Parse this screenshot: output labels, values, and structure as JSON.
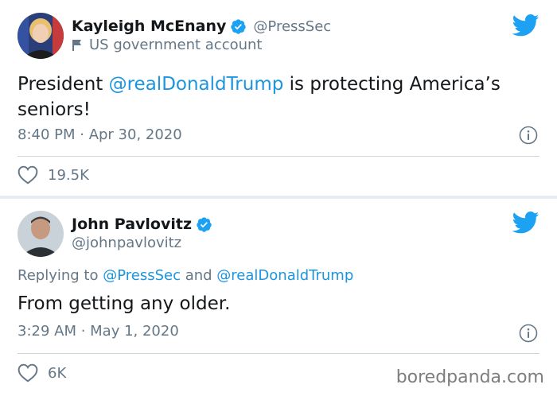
{
  "tweets": [
    {
      "display_name": "Kayleigh McEnany",
      "handle": "@PressSec",
      "badge_text": "US government account",
      "text_before": "President ",
      "mention": "@realDonaldTrump",
      "text_after": " is protecting America’s seniors!",
      "timestamp": "8:40 PM · Apr 30, 2020",
      "likes": "19.5K"
    },
    {
      "display_name": "John Pavlovitz",
      "handle": "@johnpavlovitz",
      "replying_prefix": "Replying to ",
      "replying_to_1": "@PressSec",
      "replying_and": " and ",
      "replying_to_2": "@realDonaldTrump",
      "text": "From getting any older.",
      "timestamp": "3:29 AM · May 1, 2020",
      "likes": "6K"
    }
  ],
  "watermark": "boredpanda.com",
  "colors": {
    "twitter_blue": "#1da1f2",
    "link_blue": "#1b95e0",
    "secondary_text": "#657786",
    "primary_text": "#14171a",
    "divider": "#ccd6dd"
  },
  "icons": [
    "verified-badge-icon",
    "twitter-bird-icon",
    "government-flag-icon",
    "info-icon",
    "heart-icon"
  ]
}
